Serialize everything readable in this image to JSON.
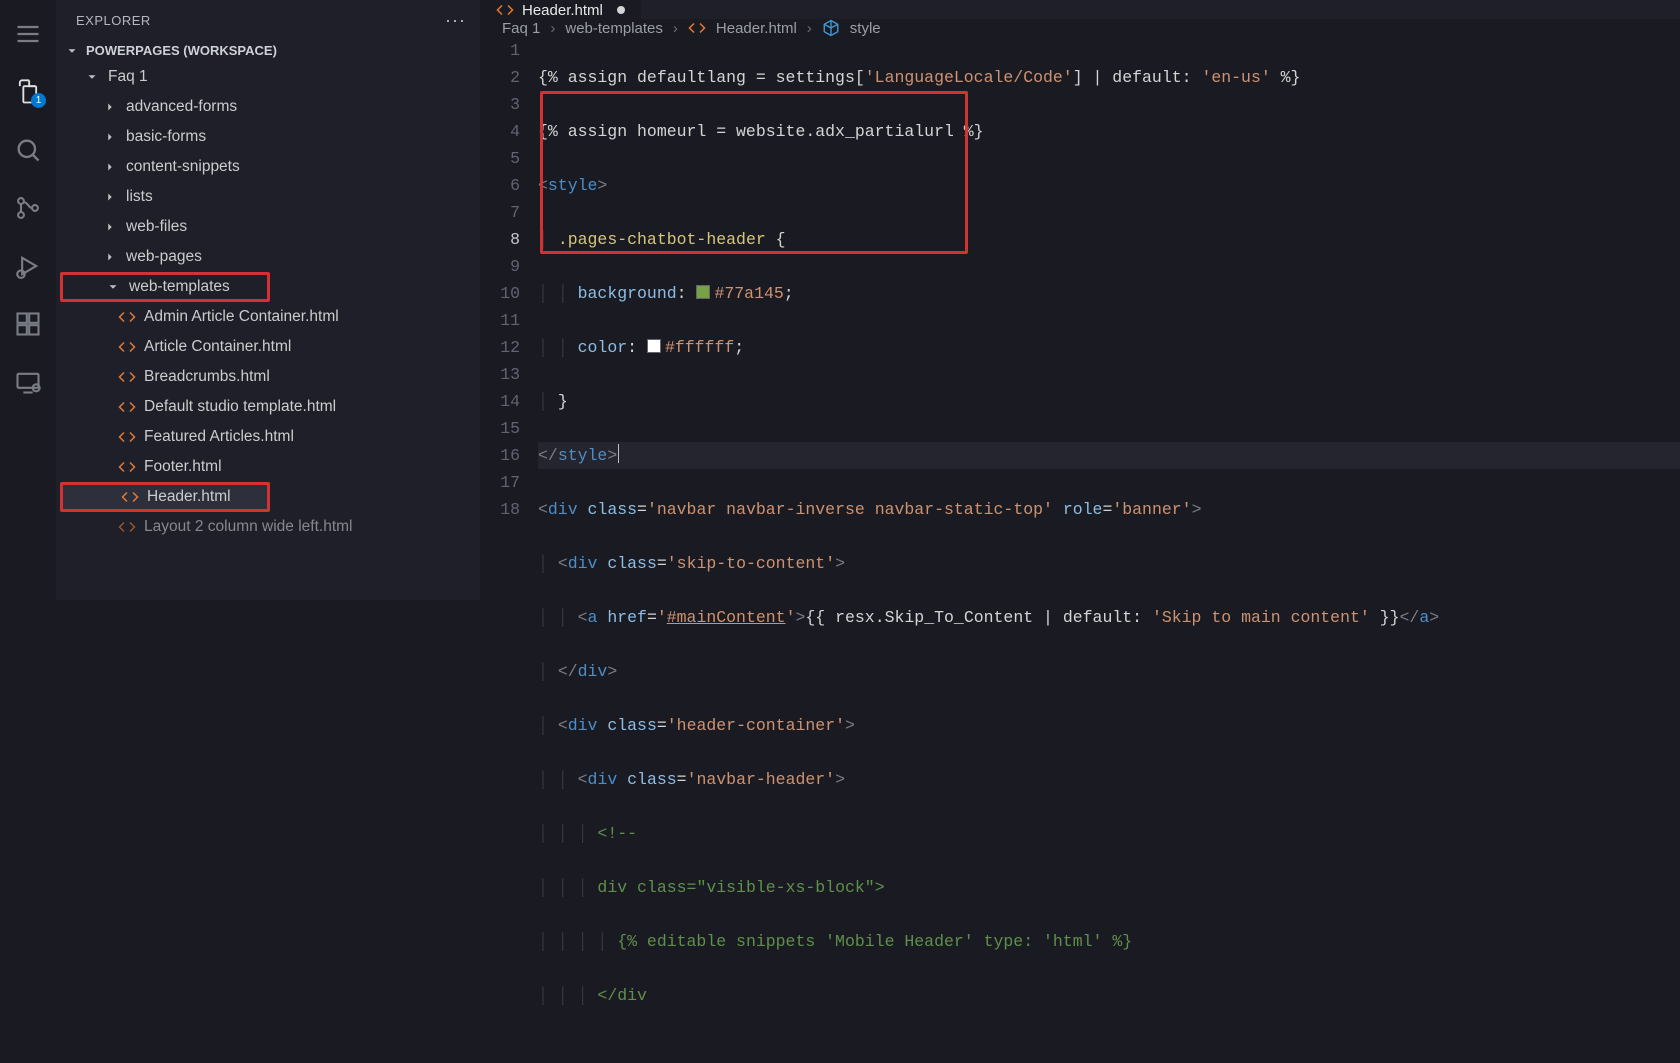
{
  "activity": {
    "explorer_badge": "1"
  },
  "sidebar": {
    "title": "EXPLORER",
    "section": "POWERPAGES (WORKSPACE)",
    "root": "Faq 1",
    "folders": {
      "advancedForms": "advanced-forms",
      "basicForms": "basic-forms",
      "contentSnippets": "content-snippets",
      "lists": "lists",
      "webFiles": "web-files",
      "webPages": "web-pages",
      "webTemplates": "web-templates"
    },
    "templates": {
      "adminArticle": "Admin Article Container.html",
      "articleContainer": "Article Container.html",
      "breadcrumbs": "Breadcrumbs.html",
      "defaultStudio": "Default studio template.html",
      "featured": "Featured Articles.html",
      "footer": "Footer.html",
      "header": "Header.html",
      "layout2col": "Layout 2 column wide left.html"
    }
  },
  "tab": {
    "filename": "Header.html"
  },
  "breadcrumbs": {
    "seg1": "Faq 1",
    "seg2": "web-templates",
    "seg3": "Header.html",
    "seg4": "style"
  },
  "code": {
    "l1a": "{% assign defaultlang = settings[",
    "l1b": "'LanguageLocale/Code'",
    "l1c": "] | default: ",
    "l1d": "'en-us'",
    "l1e": " %}",
    "l2a": "{% assign homeurl = website.adx_partialurl %}",
    "l3open": "<",
    "l3tag": "style",
    "l3close": ">",
    "l4sel": ".pages-chatbot-header",
    "l4brace": " {",
    "l5prop": "background",
    "l5col": ": ",
    "l5val": "#77a145",
    "l5semi": ";",
    "l6prop": "color",
    "l6col": ": ",
    "l6val": "#ffffff",
    "l6semi": ";",
    "l7brace": "}",
    "l8closeopen": "</",
    "l8tag": "style",
    "l8close": ">",
    "l9_open": "<",
    "l9_div": "div",
    "l9_sp": " ",
    "l9_class": "class",
    "l9_eq": "=",
    "l9_cval": "'navbar navbar-inverse navbar-static-top'",
    "l9_role": "role",
    "l9_rval": "'banner'",
    "l9_close": ">",
    "l10_open": "<",
    "l10_div": "div",
    "l10_class": "class",
    "l10_eq": "=",
    "l10_cval": "'skip-to-content'",
    "l10_close": ">",
    "l11_open": "<",
    "l11_a": "a",
    "l11_href": "href",
    "l11_eq": "=",
    "l11_q": "'",
    "l11_link": "#mainContent",
    "l11_close": ">",
    "l11_txt": "{{ resx.Skip_To_Content | default: ",
    "l11_str": "'Skip to main content'",
    "l11_txt2": " }}",
    "l11_closeA": "</",
    "l11_closeA2": ">",
    "l12_open": "</",
    "l12_div": "div",
    "l12_close": ">",
    "l13_open": "<",
    "l13_div": "div",
    "l13_class": "class",
    "l13_eq": "=",
    "l13_cval": "'header-container'",
    "l13_close": ">",
    "l14_open": "<",
    "l14_div": "div",
    "l14_class": "class",
    "l14_eq": "=",
    "l14_cval": "'navbar-header'",
    "l14_close": ">",
    "l15_cmt": "<!--",
    "l16a": "div class=",
    "l16b": "\"visible-xs-block\"",
    "l16c": ">",
    "l17a": "{% editable snippets ",
    "l17b": "'Mobile Header'",
    "l17c": " type: ",
    "l17d": "'html'",
    "l17e": " %}",
    "l18": "</div"
  }
}
